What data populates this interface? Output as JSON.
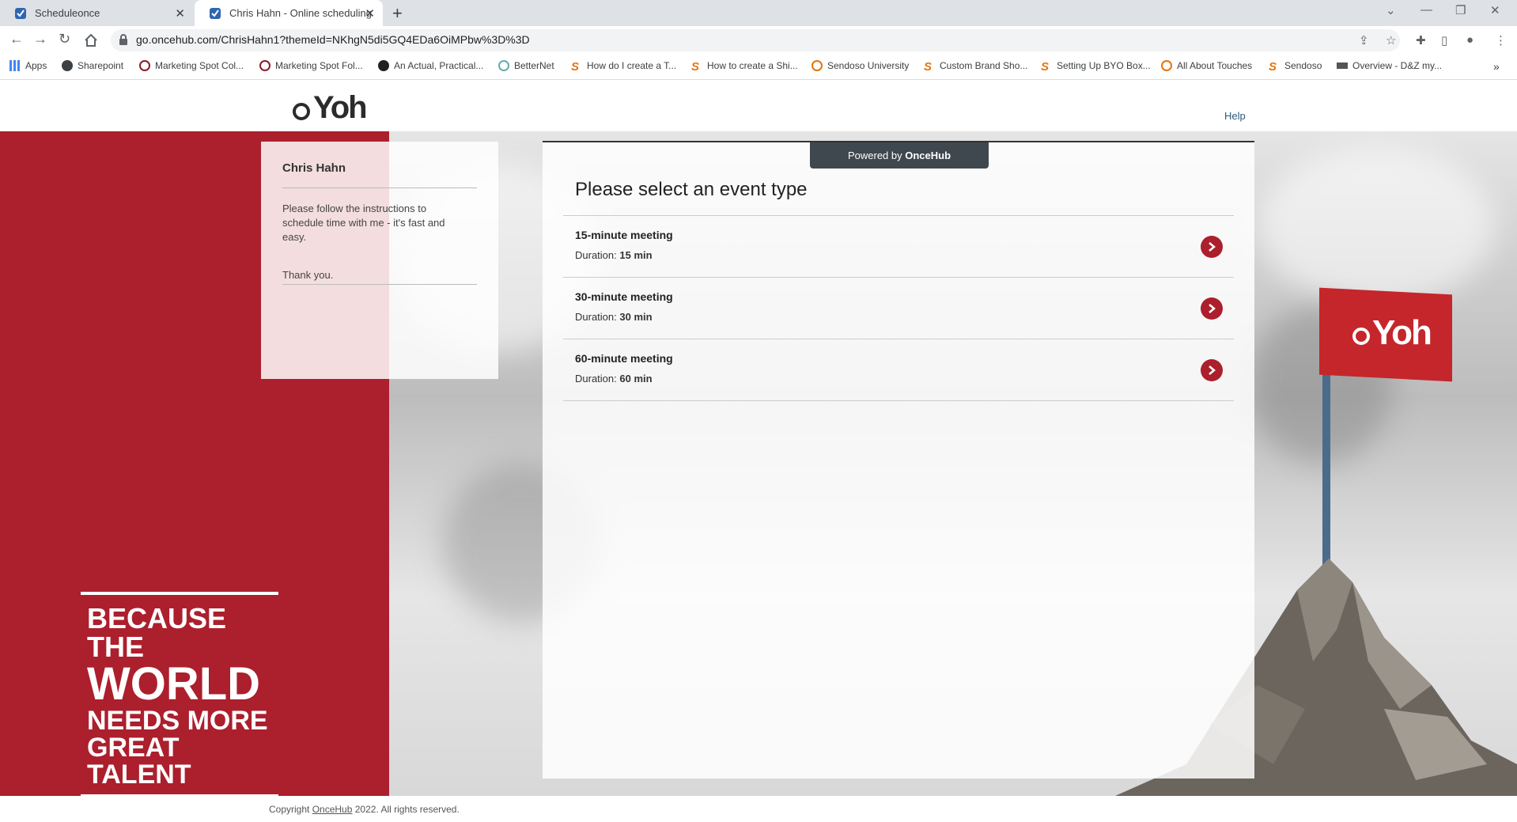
{
  "browser": {
    "tabs": [
      {
        "title": "Scheduleonce"
      },
      {
        "title": "Chris Hahn - Online scheduling"
      }
    ],
    "url": "go.oncehub.com/ChrisHahn1?themeId=NKhgN5di5GQ4EDa6OiMPbw%3D%3D",
    "bookmarks": [
      {
        "label": "Apps"
      },
      {
        "label": "Sharepoint"
      },
      {
        "label": "Marketing Spot Col..."
      },
      {
        "label": "Marketing Spot Fol..."
      },
      {
        "label": "An Actual, Practical..."
      },
      {
        "label": "BetterNet"
      },
      {
        "label": "How do I create a T..."
      },
      {
        "label": "How to create a Shi..."
      },
      {
        "label": "Sendoso University"
      },
      {
        "label": "Custom Brand Sho..."
      },
      {
        "label": "Setting Up BYO Box..."
      },
      {
        "label": "All About Touches"
      },
      {
        "label": "Sendoso"
      },
      {
        "label": "Overview - D&Z my..."
      }
    ]
  },
  "header": {
    "logo_text": "Yoh",
    "help": "Help"
  },
  "tagline": {
    "line1": "BECAUSE THE",
    "line2": "WORLD",
    "line3": "NEEDS MORE",
    "line4": "GREAT TALENT"
  },
  "profile": {
    "name": "Chris Hahn",
    "message": "Please follow the instructions to schedule time with me - it's fast and easy.",
    "thanks": "Thank you."
  },
  "main": {
    "powered_prefix": "Powered by ",
    "powered_brand": "OnceHub",
    "title": "Please select an event type",
    "duration_label": "Duration: ",
    "events": [
      {
        "name": "15-minute meeting",
        "duration": "15 min"
      },
      {
        "name": "30-minute meeting",
        "duration": "30 min"
      },
      {
        "name": "60-minute meeting",
        "duration": "60 min"
      }
    ]
  },
  "flag": {
    "logo_text": "Yoh"
  },
  "footer": {
    "prefix": "Copyright ",
    "link": "OnceHub",
    "suffix": " 2022. All rights reserved."
  },
  "colors": {
    "brand_red": "#ac1f2d",
    "powered_bar": "#3f474f"
  }
}
